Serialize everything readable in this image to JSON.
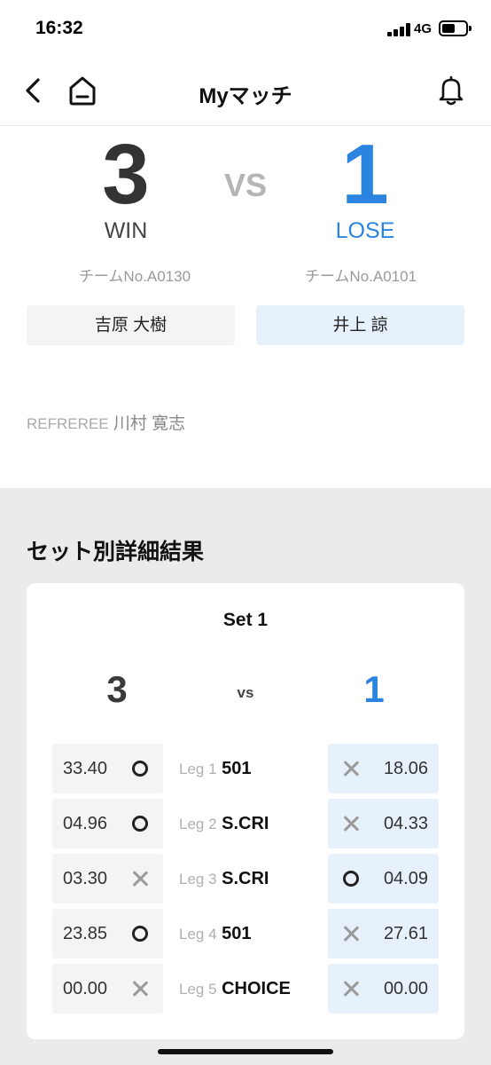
{
  "status": {
    "time": "16:32",
    "network": "4G"
  },
  "nav": {
    "title": "Myマッチ"
  },
  "match": {
    "left": {
      "score": "3",
      "result": "WIN",
      "team_no": "チームNo.A0130",
      "player": "吉原 大樹"
    },
    "right": {
      "score": "1",
      "result": "LOSE",
      "team_no": "チームNo.A0101",
      "player": "井上 諒"
    },
    "vs": "VS",
    "referee_label": "REFREREE",
    "referee_name": "川村 寛志"
  },
  "details": {
    "title": "セット別詳細結果",
    "sets": [
      {
        "title": "Set 1",
        "left_score": "3",
        "vs": "vs",
        "right_score": "1",
        "legs": [
          {
            "label": "Leg 1",
            "game": "501",
            "left_value": "33.40",
            "left_mark": "circle",
            "right_value": "18.06",
            "right_mark": "cross"
          },
          {
            "label": "Leg 2",
            "game": "S.CRI",
            "left_value": "04.96",
            "left_mark": "circle",
            "right_value": "04.33",
            "right_mark": "cross"
          },
          {
            "label": "Leg 3",
            "game": "S.CRI",
            "left_value": "03.30",
            "left_mark": "cross",
            "right_value": "04.09",
            "right_mark": "circle"
          },
          {
            "label": "Leg 4",
            "game": "501",
            "left_value": "23.85",
            "left_mark": "circle",
            "right_value": "27.61",
            "right_mark": "cross"
          },
          {
            "label": "Leg 5",
            "game": "CHOICE",
            "left_value": "00.00",
            "left_mark": "cross",
            "right_value": "00.00",
            "right_mark": "cross"
          }
        ]
      }
    ]
  },
  "icons": {
    "back": "chevron-left-icon",
    "home": "home-icon",
    "bell": "bell-icon",
    "win_mark": "circle-icon",
    "lose_mark": "cross-icon"
  },
  "colors": {
    "accent": "#2a84e0",
    "left_cell": "#f4f4f4",
    "right_cell": "#e7f1fc",
    "section_bg": "#ebebeb"
  }
}
